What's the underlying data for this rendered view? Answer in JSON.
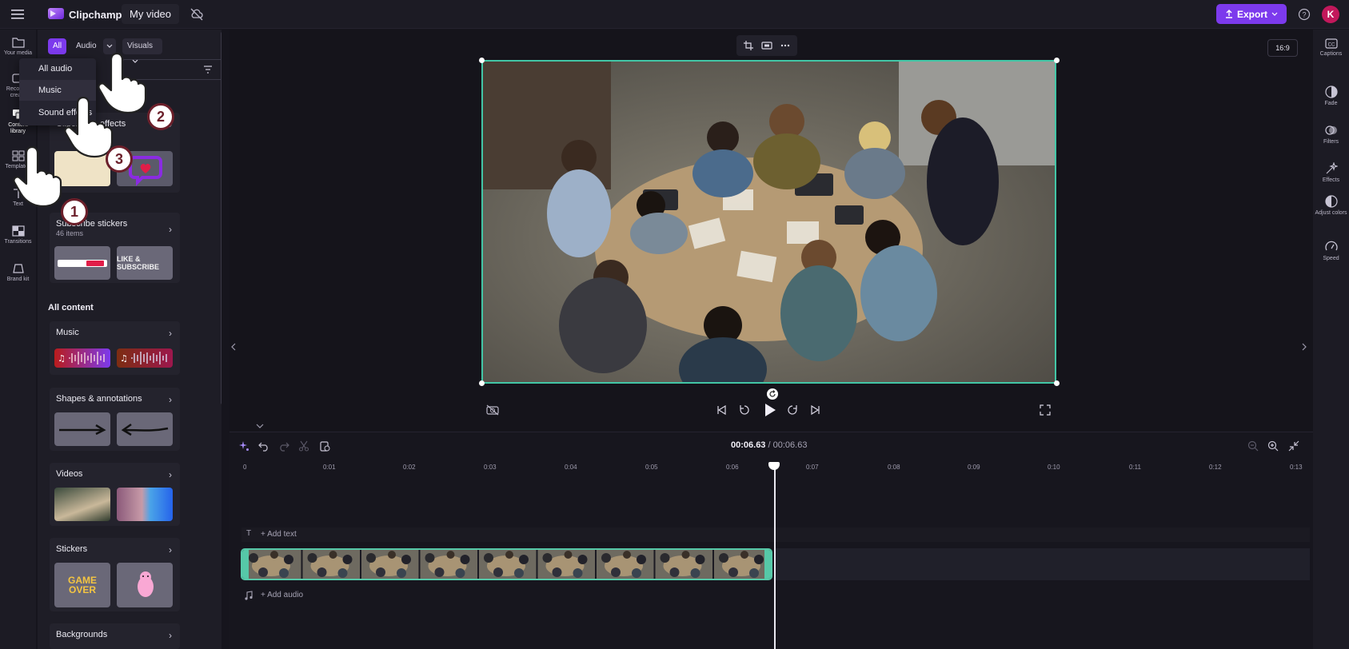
{
  "app": {
    "name": "Clipchamp",
    "video_title": "My video",
    "export_label": "Export",
    "avatar_initial": "K",
    "accent": "#7c3aed"
  },
  "left_rail": [
    {
      "label": "Your media",
      "icon": "folder-icon"
    },
    {
      "label": "Record & create",
      "icon": "record-icon"
    },
    {
      "label": "Content library",
      "icon": "library-icon"
    },
    {
      "label": "Templates",
      "icon": "templates-icon"
    },
    {
      "label": "Text",
      "icon": "text-icon"
    },
    {
      "label": "Transitions",
      "icon": "transitions-icon"
    },
    {
      "label": "Brand kit",
      "icon": "brand-kit-icon"
    }
  ],
  "panel": {
    "filters": {
      "all": "All",
      "audio": "Audio",
      "visuals": "Visuals"
    },
    "dropdown": [
      "All audio",
      "Music",
      "Sound effects"
    ],
    "featured": [
      {
        "title": "Clipchamp effects"
      },
      {
        "title": "Subscribe stickers",
        "subtitle": "46 items",
        "thumb2_text": "LIKE & SUBSCRIBE"
      }
    ],
    "all_content_heading": "All content",
    "categories": [
      {
        "title": "Music"
      },
      {
        "title": "Shapes & annotations"
      },
      {
        "title": "Videos"
      },
      {
        "title": "Stickers",
        "thumb1_text": "GAME OVER"
      },
      {
        "title": "Backgrounds"
      }
    ]
  },
  "right_rail": [
    {
      "label": "Captions",
      "icon": "captions-icon"
    },
    {
      "label": "Fade",
      "icon": "fade-icon"
    },
    {
      "label": "Filters",
      "icon": "filters-icon"
    },
    {
      "label": "Effects",
      "icon": "effects-icon"
    },
    {
      "label": "Adjust colors",
      "icon": "adjust-colors-icon"
    },
    {
      "label": "Speed",
      "icon": "speed-icon"
    }
  ],
  "preview": {
    "aspect_ratio": "16:9"
  },
  "timeline": {
    "current_time": "00:06.63",
    "total_time": "/ 00:06.63",
    "ruler": [
      "0",
      "0:01",
      "0:02",
      "0:03",
      "0:04",
      "0:05",
      "0:06",
      "0:07",
      "0:08",
      "0:09",
      "0:10",
      "0:11",
      "0:12",
      "0:13"
    ],
    "add_text": "+ Add text",
    "add_audio": "+ Add audio"
  },
  "tutorial_steps": [
    "1",
    "2",
    "3"
  ]
}
